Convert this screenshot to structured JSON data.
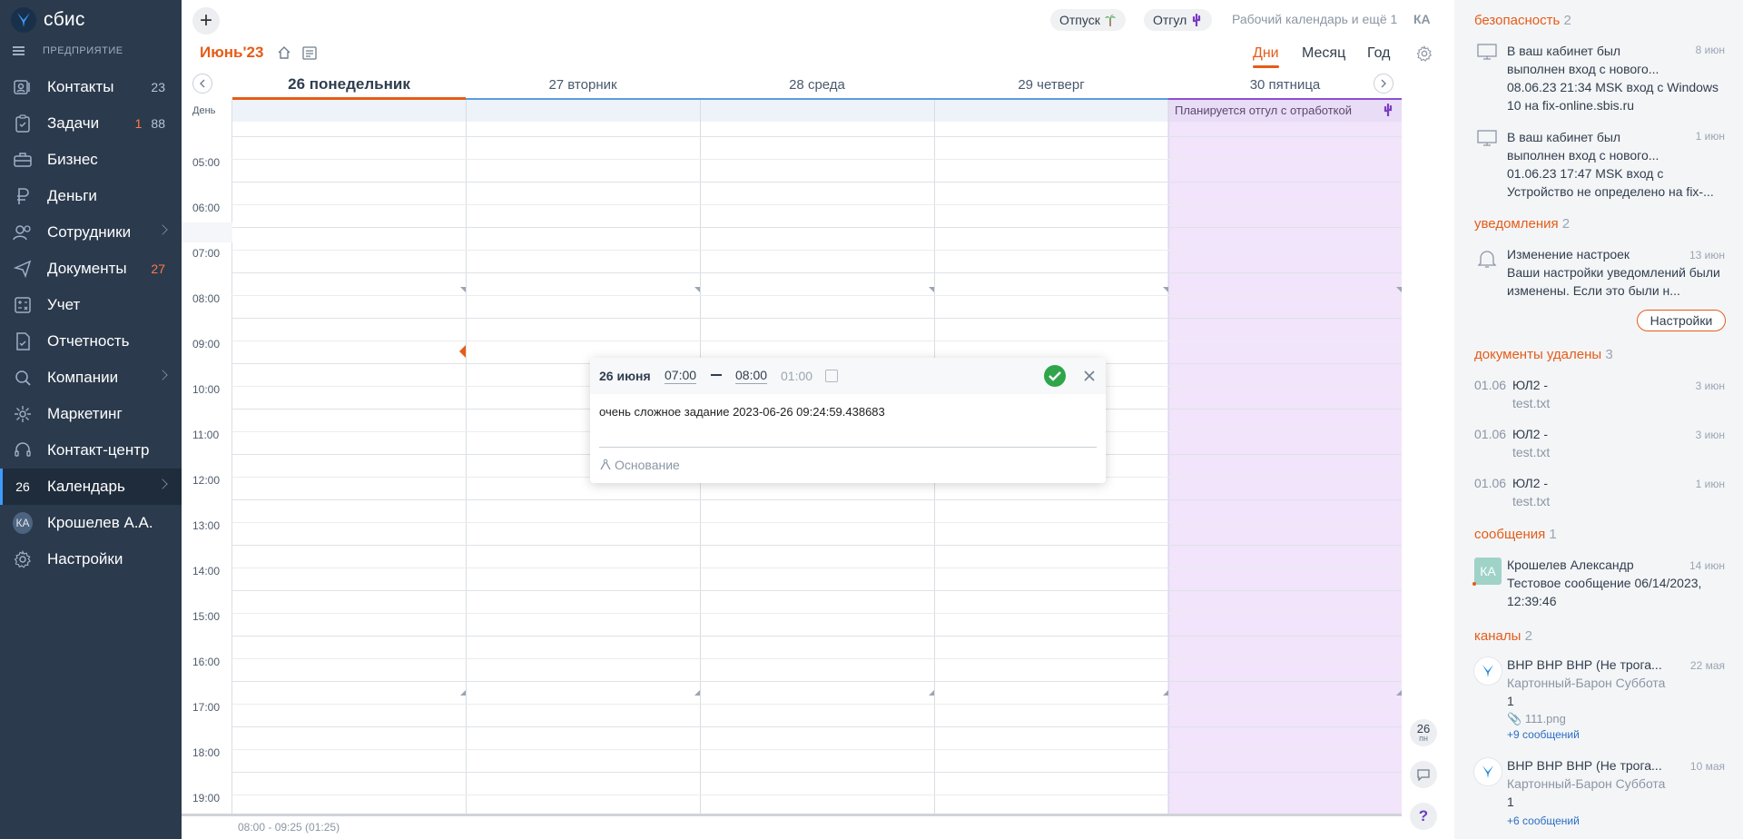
{
  "app": {
    "logo_text": "сбис",
    "org_label": "ПРЕДПРИЯТИЕ"
  },
  "sidebar": {
    "items": [
      {
        "label": "Контакты",
        "count": "23",
        "icon": "contacts-icon"
      },
      {
        "label": "Задачи",
        "count_red": "1",
        "count": "88",
        "icon": "tasks-icon"
      },
      {
        "label": "Бизнес",
        "icon": "business-icon"
      },
      {
        "label": "Деньги",
        "icon": "money-icon"
      },
      {
        "label": "Сотрудники",
        "icon": "employees-icon",
        "chevron": true
      },
      {
        "label": "Документы",
        "count_red": "27",
        "icon": "documents-icon"
      },
      {
        "label": "Учет",
        "icon": "accounting-icon"
      },
      {
        "label": "Отчетность",
        "icon": "reports-icon"
      },
      {
        "label": "Компании",
        "icon": "companies-icon",
        "chevron": true
      },
      {
        "label": "Маркетинг",
        "icon": "marketing-icon"
      },
      {
        "label": "Контакт-центр",
        "icon": "contact-center-icon"
      },
      {
        "label": "Календарь",
        "icon_text": "26",
        "icon": "calendar-icon",
        "chevron": true,
        "active": true
      },
      {
        "label": "Крошелев А.А.",
        "icon_text": "КА",
        "icon": "user-avatar"
      },
      {
        "label": "Настройки",
        "icon": "settings-icon"
      }
    ]
  },
  "topbar": {
    "leave_label": "Отпуск",
    "timeoff_label": "Отгул",
    "work_calendar": "Рабочий календарь и ещё 1",
    "user_initials": "КА"
  },
  "calendar": {
    "month_title": "Июнь'23",
    "views": {
      "days": "Дни",
      "month": "Месяц",
      "year": "Год"
    },
    "days": [
      "26 понедельник",
      "27 вторник",
      "28 среда",
      "29 четверг",
      "30 пятница"
    ],
    "allday_label": "День",
    "timeoff_banner": "Планируется отгул с отработкой",
    "hours": [
      "05:00",
      "06:00",
      "07:00",
      "08:00",
      "09:00",
      "10:00",
      "11:00",
      "12:00",
      "13:00",
      "14:00",
      "15:00",
      "16:00",
      "17:00",
      "18:00",
      "19:00"
    ],
    "footer_range": "08:00 -  09:25  (01:25)",
    "side_date_num": "26",
    "side_date_dow": "пн"
  },
  "popup": {
    "date": "26 июня",
    "start": "07:00",
    "end": "08:00",
    "duration": "01:00",
    "description": "очень сложное задание 2023-06-26 09:24:59.438683",
    "basis_label": "Основание"
  },
  "right_panel": {
    "security": {
      "title": "безопасность",
      "count": "2",
      "items": [
        {
          "title": "В ваш кабинет был выполнен вход с нового...",
          "date": "8 июн",
          "text": "08.06.23 21:34 MSK вход с Windows 10 на fix-online.sbis.ru"
        },
        {
          "title": "В ваш кабинет был выполнен вход с нового...",
          "date": "1 июн",
          "text": "01.06.23 17:47 MSK вход с Устройство не определено на fix-..."
        }
      ]
    },
    "notifications": {
      "title": "уведомления",
      "count": "2",
      "item": {
        "title": "Изменение настроек",
        "date": "13 июн",
        "text": "Ваши настройки уведомлений были изменены. Если это были н..."
      },
      "button": "Настройки"
    },
    "docs_deleted": {
      "title": "документы удалены",
      "count": "3",
      "items": [
        {
          "date": "01.06",
          "name": "ЮЛ2 -",
          "file": "test.txt",
          "time": "3 июн"
        },
        {
          "date": "01.06",
          "name": "ЮЛ2 -",
          "file": "test.txt",
          "time": "3 июн"
        },
        {
          "date": "01.06",
          "name": "ЮЛ2 -",
          "file": "test.txt",
          "time": "1 июн"
        }
      ]
    },
    "messages": {
      "title": "сообщения",
      "count": "1",
      "item": {
        "avatar": "КА",
        "from": "Крошелев Александр",
        "date": "14 июн",
        "text": "Тестовое сообщение 06/14/2023, 12:39:46"
      }
    },
    "channels": {
      "title": "каналы",
      "count": "2",
      "items": [
        {
          "title": "ВНР ВНР ВНР (Не трога...",
          "date": "22 мая",
          "author": "Картонный-Барон Суббота",
          "body": "1",
          "attachment": "111.png",
          "more": "+9 сообщений"
        },
        {
          "title": "ВНР ВНР ВНР (Не трога...",
          "date": "10 мая",
          "author": "Картонный-Барон Суббота",
          "body": "1",
          "more": "+6 сообщений"
        }
      ]
    }
  },
  "colors": {
    "accent": "#e55c18",
    "sidebar_bg": "#2b3a4d",
    "vacation_bg": "#f1e4fb",
    "ok_green": "#30a54b"
  }
}
